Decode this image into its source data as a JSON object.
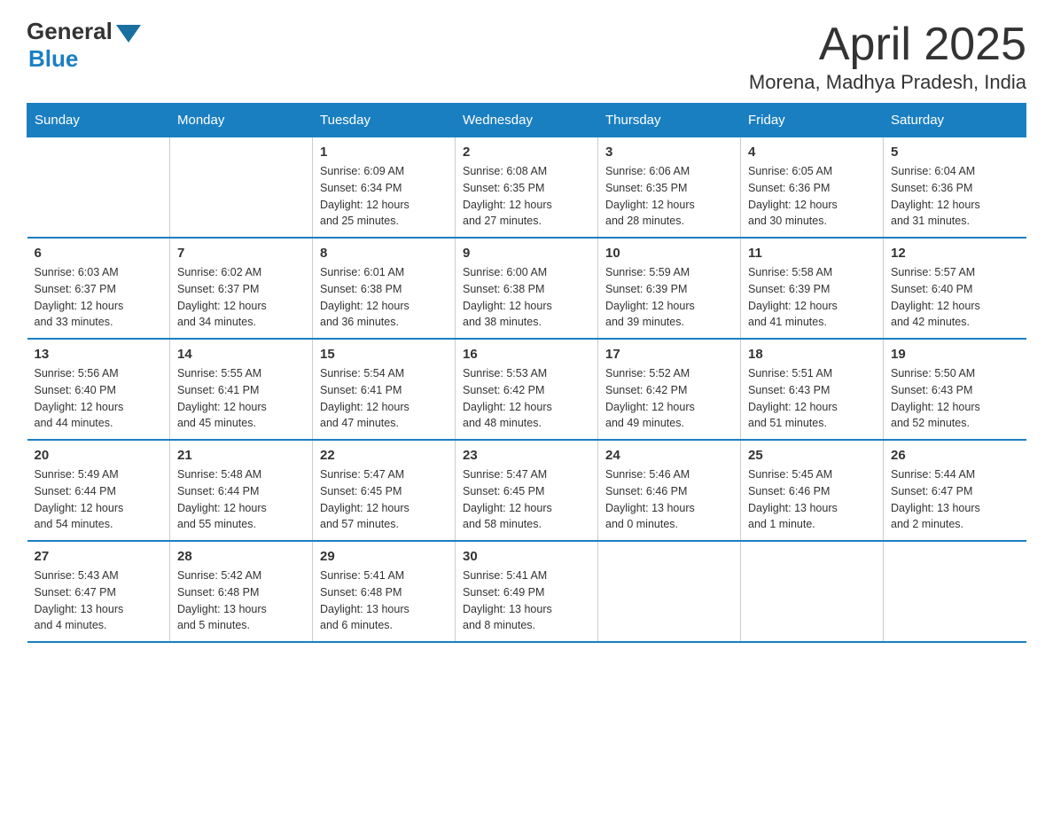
{
  "header": {
    "logo_general": "General",
    "logo_blue": "Blue",
    "month_title": "April 2025",
    "location": "Morena, Madhya Pradesh, India"
  },
  "weekdays": [
    "Sunday",
    "Monday",
    "Tuesday",
    "Wednesday",
    "Thursday",
    "Friday",
    "Saturday"
  ],
  "weeks": [
    [
      {
        "day": "",
        "info": ""
      },
      {
        "day": "",
        "info": ""
      },
      {
        "day": "1",
        "info": "Sunrise: 6:09 AM\nSunset: 6:34 PM\nDaylight: 12 hours\nand 25 minutes."
      },
      {
        "day": "2",
        "info": "Sunrise: 6:08 AM\nSunset: 6:35 PM\nDaylight: 12 hours\nand 27 minutes."
      },
      {
        "day": "3",
        "info": "Sunrise: 6:06 AM\nSunset: 6:35 PM\nDaylight: 12 hours\nand 28 minutes."
      },
      {
        "day": "4",
        "info": "Sunrise: 6:05 AM\nSunset: 6:36 PM\nDaylight: 12 hours\nand 30 minutes."
      },
      {
        "day": "5",
        "info": "Sunrise: 6:04 AM\nSunset: 6:36 PM\nDaylight: 12 hours\nand 31 minutes."
      }
    ],
    [
      {
        "day": "6",
        "info": "Sunrise: 6:03 AM\nSunset: 6:37 PM\nDaylight: 12 hours\nand 33 minutes."
      },
      {
        "day": "7",
        "info": "Sunrise: 6:02 AM\nSunset: 6:37 PM\nDaylight: 12 hours\nand 34 minutes."
      },
      {
        "day": "8",
        "info": "Sunrise: 6:01 AM\nSunset: 6:38 PM\nDaylight: 12 hours\nand 36 minutes."
      },
      {
        "day": "9",
        "info": "Sunrise: 6:00 AM\nSunset: 6:38 PM\nDaylight: 12 hours\nand 38 minutes."
      },
      {
        "day": "10",
        "info": "Sunrise: 5:59 AM\nSunset: 6:39 PM\nDaylight: 12 hours\nand 39 minutes."
      },
      {
        "day": "11",
        "info": "Sunrise: 5:58 AM\nSunset: 6:39 PM\nDaylight: 12 hours\nand 41 minutes."
      },
      {
        "day": "12",
        "info": "Sunrise: 5:57 AM\nSunset: 6:40 PM\nDaylight: 12 hours\nand 42 minutes."
      }
    ],
    [
      {
        "day": "13",
        "info": "Sunrise: 5:56 AM\nSunset: 6:40 PM\nDaylight: 12 hours\nand 44 minutes."
      },
      {
        "day": "14",
        "info": "Sunrise: 5:55 AM\nSunset: 6:41 PM\nDaylight: 12 hours\nand 45 minutes."
      },
      {
        "day": "15",
        "info": "Sunrise: 5:54 AM\nSunset: 6:41 PM\nDaylight: 12 hours\nand 47 minutes."
      },
      {
        "day": "16",
        "info": "Sunrise: 5:53 AM\nSunset: 6:42 PM\nDaylight: 12 hours\nand 48 minutes."
      },
      {
        "day": "17",
        "info": "Sunrise: 5:52 AM\nSunset: 6:42 PM\nDaylight: 12 hours\nand 49 minutes."
      },
      {
        "day": "18",
        "info": "Sunrise: 5:51 AM\nSunset: 6:43 PM\nDaylight: 12 hours\nand 51 minutes."
      },
      {
        "day": "19",
        "info": "Sunrise: 5:50 AM\nSunset: 6:43 PM\nDaylight: 12 hours\nand 52 minutes."
      }
    ],
    [
      {
        "day": "20",
        "info": "Sunrise: 5:49 AM\nSunset: 6:44 PM\nDaylight: 12 hours\nand 54 minutes."
      },
      {
        "day": "21",
        "info": "Sunrise: 5:48 AM\nSunset: 6:44 PM\nDaylight: 12 hours\nand 55 minutes."
      },
      {
        "day": "22",
        "info": "Sunrise: 5:47 AM\nSunset: 6:45 PM\nDaylight: 12 hours\nand 57 minutes."
      },
      {
        "day": "23",
        "info": "Sunrise: 5:47 AM\nSunset: 6:45 PM\nDaylight: 12 hours\nand 58 minutes."
      },
      {
        "day": "24",
        "info": "Sunrise: 5:46 AM\nSunset: 6:46 PM\nDaylight: 13 hours\nand 0 minutes."
      },
      {
        "day": "25",
        "info": "Sunrise: 5:45 AM\nSunset: 6:46 PM\nDaylight: 13 hours\nand 1 minute."
      },
      {
        "day": "26",
        "info": "Sunrise: 5:44 AM\nSunset: 6:47 PM\nDaylight: 13 hours\nand 2 minutes."
      }
    ],
    [
      {
        "day": "27",
        "info": "Sunrise: 5:43 AM\nSunset: 6:47 PM\nDaylight: 13 hours\nand 4 minutes."
      },
      {
        "day": "28",
        "info": "Sunrise: 5:42 AM\nSunset: 6:48 PM\nDaylight: 13 hours\nand 5 minutes."
      },
      {
        "day": "29",
        "info": "Sunrise: 5:41 AM\nSunset: 6:48 PM\nDaylight: 13 hours\nand 6 minutes."
      },
      {
        "day": "30",
        "info": "Sunrise: 5:41 AM\nSunset: 6:49 PM\nDaylight: 13 hours\nand 8 minutes."
      },
      {
        "day": "",
        "info": ""
      },
      {
        "day": "",
        "info": ""
      },
      {
        "day": "",
        "info": ""
      }
    ]
  ]
}
